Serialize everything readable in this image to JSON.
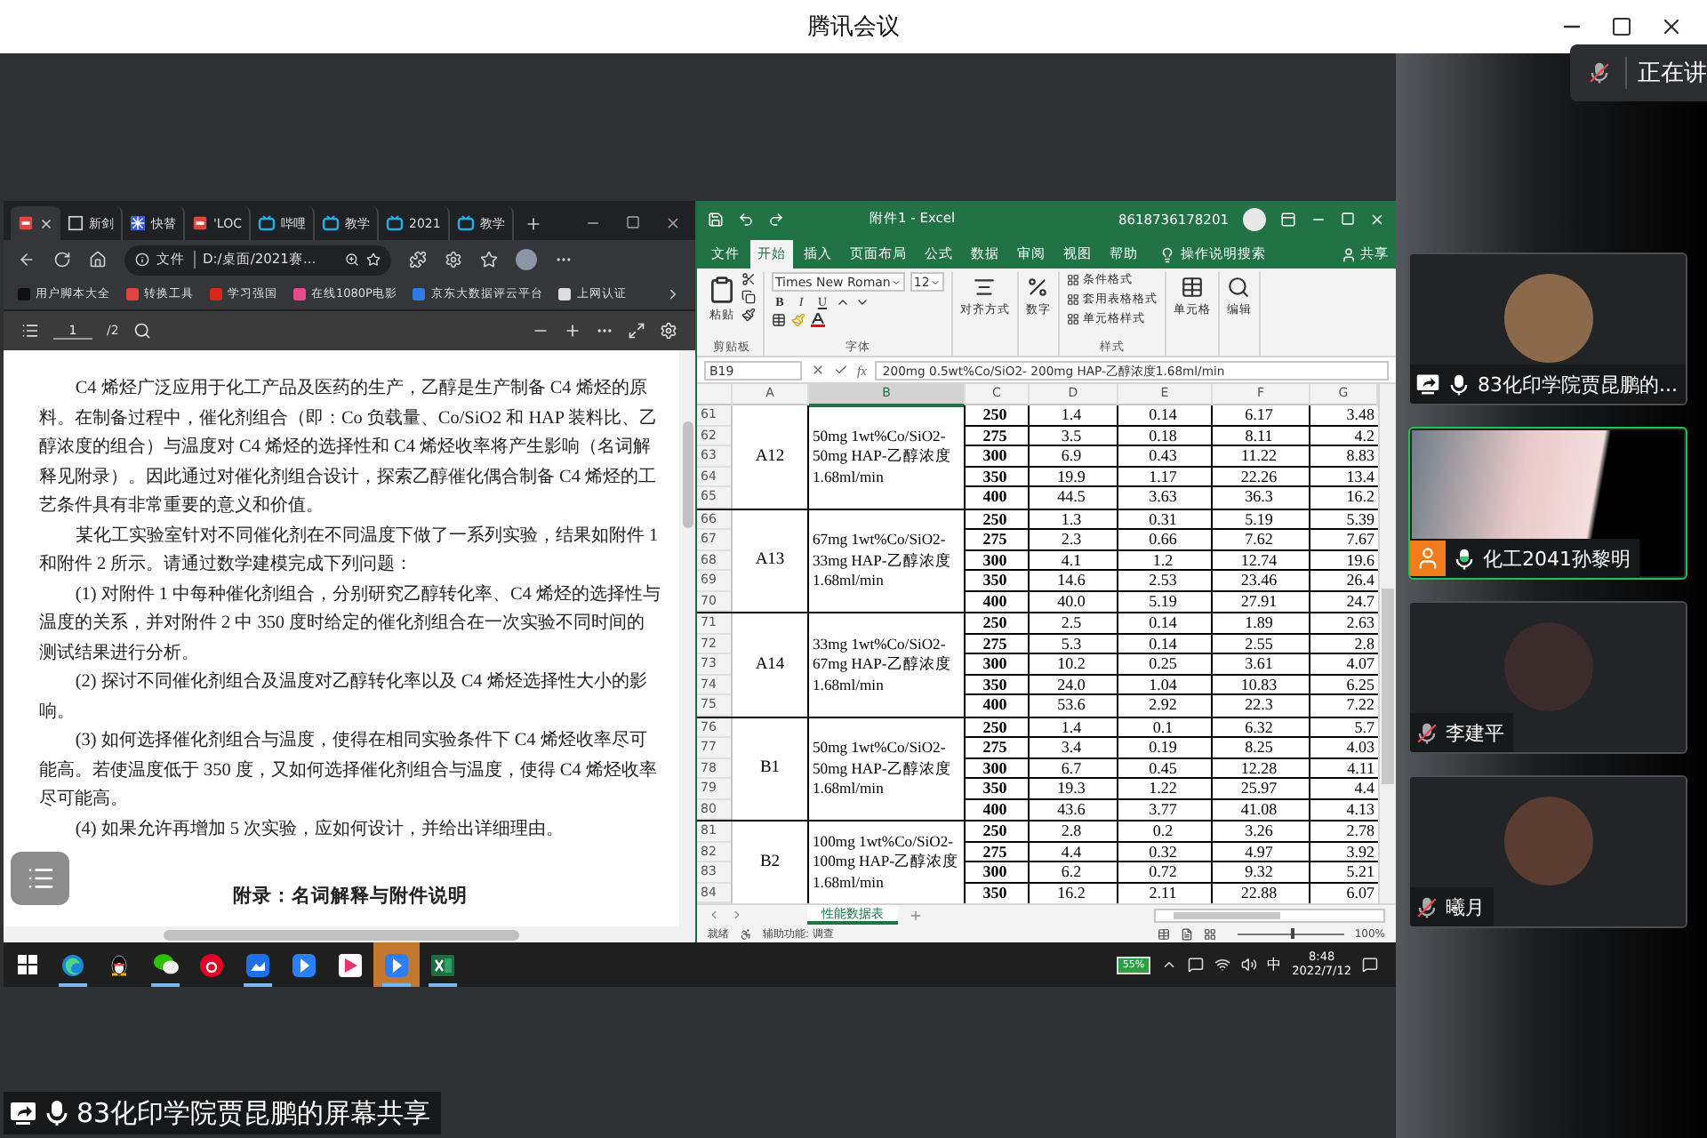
{
  "window": {
    "title": "腾讯会议"
  },
  "toast": {
    "mic_muted": true,
    "text": "正在讲"
  },
  "browser": {
    "tabs": [
      {
        "kind": "pdf",
        "selected": true
      },
      {
        "kind": "app",
        "title": "新剑",
        "selected": false
      },
      {
        "kind": "snow",
        "title": "快替",
        "selected": false
      },
      {
        "kind": "pdf",
        "title": "'LOC",
        "selected": false
      },
      {
        "kind": "tv",
        "title": "哔哩",
        "selected": false
      },
      {
        "kind": "tv",
        "title": "教学",
        "selected": false
      },
      {
        "kind": "tv",
        "title": "2021",
        "selected": false
      },
      {
        "kind": "tv",
        "title": "教学",
        "selected": false
      }
    ],
    "address": {
      "scheme": "文件",
      "url": "D:/桌面/2021赛..."
    },
    "bookmarks": [
      "用户脚本大全",
      "转换工具",
      "学习强国",
      "在线1080P电影",
      "京东大数据评云平台",
      "上网认证"
    ],
    "pdf": {
      "page": "1",
      "pages": "/2"
    },
    "paragraphs": [
      "C4 烯烃广泛应用于化工产品及医药的生产，乙醇是生产制备 C4 烯烃的原料。在制备过程中，催化剂组合（即：Co 负载量、Co/SiO2 和 HAP 装料比、乙醇浓度的组合）与温度对 C4 烯烃的选择性和 C4 烯烃收率将产生影响（名词解释见附录）。因此通过对催化剂组合设计，探索乙醇催化偶合制备 C4 烯烃的工艺条件具有非常重要的意义和价值。",
      "某化工实验室针对不同催化剂在不同温度下做了一系列实验，结果如附件 1 和附件 2 所示。请通过数学建模完成下列问题：",
      "(1) 对附件 1 中每种催化剂组合，分别研究乙醇转化率、C4 烯烃的选择性与温度的关系，并对附件 2 中 350 度时给定的催化剂组合在一次实验不同时间的测试结果进行分析。",
      "(2) 探讨不同催化剂组合及温度对乙醇转化率以及 C4 烯烃选择性大小的影响。",
      "(3) 如何选择催化剂组合与温度，使得在相同实验条件下 C4 烯烃收率尽可能高。若使温度低于 350 度，又如何选择催化剂组合与温度，使得 C4 烯烃收率尽可能高。",
      "(4) 如果允许再增加 5 次实验，应如何设计，并给出详细理由。"
    ],
    "heading": "附录：名词解释与附件说明"
  },
  "excel": {
    "title": "附件1 - Excel",
    "account": "8618736178201",
    "tabs": [
      {
        "label": "文件",
        "selected": false
      },
      {
        "label": "开始",
        "selected": true
      },
      {
        "label": "插入",
        "selected": false
      },
      {
        "label": "页面布局",
        "selected": false
      },
      {
        "label": "公式",
        "selected": false
      },
      {
        "label": "数据",
        "selected": false
      },
      {
        "label": "审阅",
        "selected": false
      },
      {
        "label": "视图",
        "selected": false
      },
      {
        "label": "帮助",
        "selected": false
      }
    ],
    "search": "操作说明搜索",
    "share": "共享",
    "ribbon": {
      "paste": "粘贴",
      "clipboard": "剪贴板",
      "font_name": "Times New Roman",
      "font_size": "12",
      "format_buttons": [
        "B",
        "I",
        "U"
      ],
      "font": "字体",
      "alignment": "对齐方式",
      "number": "数字",
      "style_items": [
        "条件格式",
        "套用表格格式",
        "单元格样式"
      ],
      "styles": "样式",
      "cells": "单元格",
      "editing": "编辑"
    },
    "formula": {
      "name_box": "B19",
      "fx": "fx",
      "value": "200mg 0.5wt%Co/SiO2- 200mg HAP-乙醇浓度1.68ml/min"
    },
    "columns": [
      {
        "label": "A",
        "selected": false
      },
      {
        "label": "B",
        "selected": true
      },
      {
        "label": "C",
        "selected": false
      },
      {
        "label": "D",
        "selected": false
      },
      {
        "label": "E",
        "selected": false
      },
      {
        "label": "F",
        "selected": false
      },
      {
        "label": "G",
        "selected": false
      }
    ],
    "groups": [
      {
        "label": "A12",
        "catalyst": "50mg 1wt%Co/SiO2-50mg HAP-乙醇浓度1.68ml/min",
        "rows": [
          {
            "n": "61",
            "cells": [
              "250",
              "1.4",
              "0.14",
              "6.17",
              "3.48"
            ]
          },
          {
            "n": "62",
            "cells": [
              "275",
              "3.5",
              "0.18",
              "8.11",
              "4.2"
            ]
          },
          {
            "n": "63",
            "cells": [
              "300",
              "6.9",
              "0.43",
              "11.22",
              "8.83"
            ]
          },
          {
            "n": "64",
            "cells": [
              "350",
              "19.9",
              "1.17",
              "22.26",
              "13.4"
            ]
          },
          {
            "n": "65",
            "cells": [
              "400",
              "44.5",
              "3.63",
              "36.3",
              "16.2"
            ]
          }
        ]
      },
      {
        "label": "A13",
        "catalyst": "67mg 1wt%Co/SiO2-33mg HAP-乙醇浓度1.68ml/min",
        "rows": [
          {
            "n": "66",
            "cells": [
              "250",
              "1.3",
              "0.31",
              "5.19",
              "5.39"
            ]
          },
          {
            "n": "67",
            "cells": [
              "275",
              "2.3",
              "0.66",
              "7.62",
              "7.67"
            ]
          },
          {
            "n": "68",
            "cells": [
              "300",
              "4.1",
              "1.2",
              "12.74",
              "19.6"
            ]
          },
          {
            "n": "69",
            "cells": [
              "350",
              "14.6",
              "2.53",
              "23.46",
              "26.4"
            ]
          },
          {
            "n": "70",
            "cells": [
              "400",
              "40.0",
              "5.19",
              "27.91",
              "24.7"
            ]
          }
        ]
      },
      {
        "label": "A14",
        "catalyst": "33mg 1wt%Co/SiO2-67mg HAP-乙醇浓度1.68ml/min",
        "rows": [
          {
            "n": "71",
            "cells": [
              "250",
              "2.5",
              "0.14",
              "1.89",
              "2.63"
            ]
          },
          {
            "n": "72",
            "cells": [
              "275",
              "5.3",
              "0.14",
              "2.55",
              "2.8"
            ]
          },
          {
            "n": "73",
            "cells": [
              "300",
              "10.2",
              "0.25",
              "3.61",
              "4.07"
            ]
          },
          {
            "n": "74",
            "cells": [
              "350",
              "24.0",
              "1.04",
              "10.83",
              "6.25"
            ]
          },
          {
            "n": "75",
            "cells": [
              "400",
              "53.6",
              "2.92",
              "22.3",
              "7.22"
            ]
          }
        ]
      },
      {
        "label": "B1",
        "catalyst": "50mg 1wt%Co/SiO2-50mg HAP-乙醇浓度1.68ml/min",
        "rows": [
          {
            "n": "76",
            "cells": [
              "250",
              "1.4",
              "0.1",
              "6.32",
              "5.7"
            ]
          },
          {
            "n": "77",
            "cells": [
              "275",
              "3.4",
              "0.19",
              "8.25",
              "4.03"
            ]
          },
          {
            "n": "78",
            "cells": [
              "300",
              "6.7",
              "0.45",
              "12.28",
              "4.11"
            ]
          },
          {
            "n": "79",
            "cells": [
              "350",
              "19.3",
              "1.22",
              "25.97",
              "4.4"
            ]
          },
          {
            "n": "80",
            "cells": [
              "400",
              "43.6",
              "3.77",
              "41.08",
              "4.13"
            ]
          }
        ]
      },
      {
        "label": "B2",
        "catalyst": "100mg 1wt%Co/SiO2-100mg HAP-乙醇浓度1.68ml/min",
        "rows": [
          {
            "n": "81",
            "cells": [
              "250",
              "2.8",
              "0.2",
              "3.26",
              "2.78"
            ]
          },
          {
            "n": "82",
            "cells": [
              "275",
              "4.4",
              "0.32",
              "4.97",
              "3.92"
            ]
          },
          {
            "n": "83",
            "cells": [
              "300",
              "6.2",
              "0.72",
              "9.32",
              "5.21"
            ]
          },
          {
            "n": "84",
            "cells": [
              "350",
              "16.2",
              "2.11",
              "22.88",
              "6.07"
            ]
          }
        ]
      }
    ],
    "sheets": [
      {
        "label": "性能数据表",
        "selected": true
      }
    ],
    "status": "就绪",
    "accessibility": "辅助功能: 调查",
    "zoom": "100%",
    "zoom_slider": {
      "level": 0.5
    }
  },
  "taskbar": {
    "apps": [
      {
        "kind": "browser",
        "selected": false,
        "running": true
      },
      {
        "kind": "penguin",
        "selected": false,
        "running": false
      },
      {
        "kind": "chat",
        "selected": false,
        "running": true
      },
      {
        "kind": "music",
        "selected": false,
        "running": false
      },
      {
        "kind": "cloud",
        "selected": false,
        "running": true
      },
      {
        "kind": "arrow",
        "selected": false,
        "running": false
      },
      {
        "kind": "play",
        "selected": false,
        "running": false
      },
      {
        "kind": "arrow",
        "selected": true,
        "running": true
      },
      {
        "kind": "sheet",
        "selected": false,
        "running": true
      }
    ],
    "battery": "55%",
    "ime": "中",
    "time": "8:48",
    "date": "2022/7/12"
  },
  "participants": [
    {
      "name": "83化印学院贾昆鹏的...",
      "kind": "avatar",
      "muted": false,
      "sharing": true,
      "speaking": false,
      "host": false
    },
    {
      "name": "化工2041孙黎明",
      "kind": "video",
      "muted": false,
      "sharing": false,
      "speaking": true,
      "host": true
    },
    {
      "name": "李建平",
      "kind": "avatar",
      "muted": true,
      "sharing": false,
      "speaking": false,
      "host": false
    },
    {
      "name": "曦月",
      "kind": "avatar",
      "muted": true,
      "sharing": false,
      "speaking": false,
      "host": false
    }
  ],
  "share_label": {
    "sharing": true,
    "text": "83化印学院贾昆鹏的屏幕共享"
  }
}
